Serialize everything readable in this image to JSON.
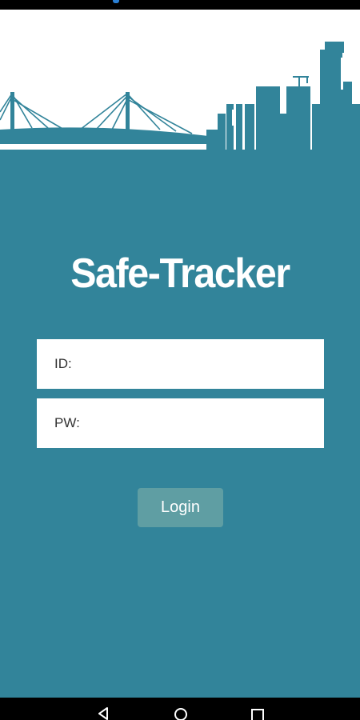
{
  "app": {
    "title": "Safe-Tracker"
  },
  "form": {
    "id_label": "ID:",
    "pw_label": "PW:",
    "login_label": "Login"
  },
  "navigation": {
    "items": [
      "back-icon",
      "home-icon",
      "recent-apps-icon"
    ]
  },
  "colors": {
    "primary_teal": "#32849a",
    "button_fill": "#5f9ea3",
    "field_background": "#ffffff",
    "text_light": "#ffffff",
    "status_accent": "#2a7fd4"
  }
}
